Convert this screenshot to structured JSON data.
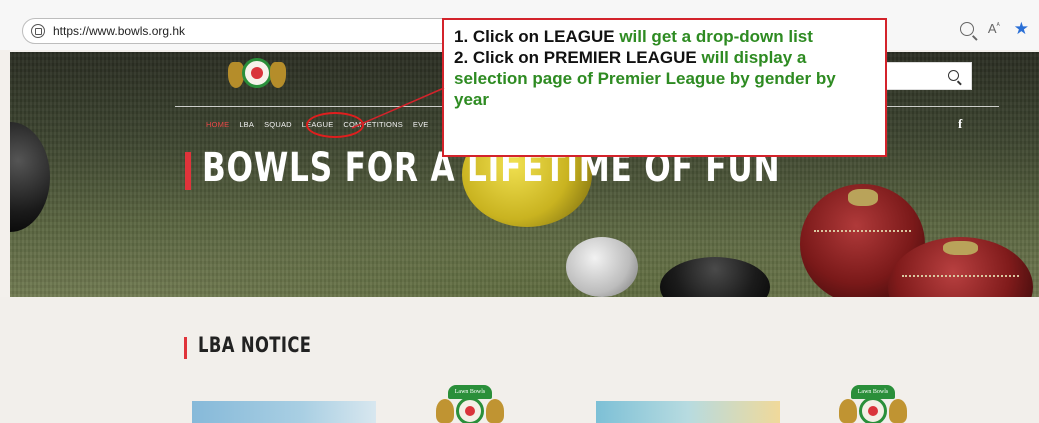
{
  "browser": {
    "url": "https://www.bowls.org.hk",
    "read_aloud_label": "A",
    "favorite_icon": "star-icon"
  },
  "site": {
    "nav": {
      "home": "HOME",
      "lba": "LBA",
      "squad": "SQUAD",
      "league": "LEAGUE",
      "competitions": "COMPETITIONS",
      "events": "EVE"
    },
    "facebook": "f",
    "hero_title": "BOWLS FOR A LIFETIME OF FUN",
    "notice_title": "LBA NOTICE",
    "logo_text": "Lawn Bowls"
  },
  "callout": {
    "line1_prefix": "1. Click on ",
    "line1_key": "LEAGUE",
    "line1_suffix": " will get a drop-down list",
    "line2_prefix": "2. Click on ",
    "line2_key": "PREMIER LEAGUE",
    "line2_suffix": " will display a selection page of Premier League by gender by year"
  },
  "colors": {
    "accent_red": "#e0333a",
    "callout_green": "#2e8b22",
    "callout_border": "#d3232b",
    "star_blue": "#2a6fd6"
  }
}
